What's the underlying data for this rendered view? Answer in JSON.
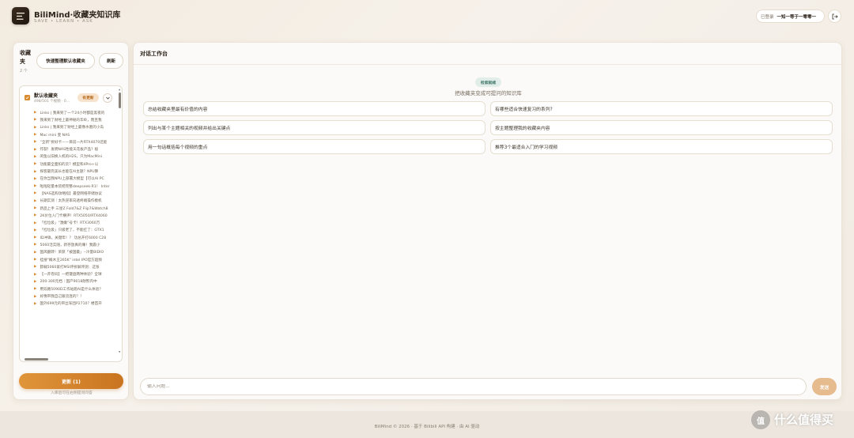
{
  "header": {
    "title": "BiliMind·收藏夹知识库",
    "subtitle": "SAVE • LEARN • ASK",
    "user_label": "已登录",
    "user_name": "一知一等于一零零一"
  },
  "sidebar": {
    "title": "收藏夹",
    "count": "2 个",
    "quick_button": "快速整理默认收藏夹",
    "refresh_button": "刷新",
    "folder": {
      "name": "默认收藏夹",
      "meta": "498/501 个视频 · 0...",
      "badge": "有更新"
    },
    "videos": [
      "Links | 我来到了一个24小时都是黑夜的",
      "我来到了财经上最神秘的华岭，而且我",
      "Links | 我来到了财经上最像水墨的小岛",
      "Mac mini 变 NAS",
      "“全新”拆好卡——目前一片RTX4070还能",
      "炸裂！发明NAS性能天花板产品？极",
      "闲鱼以旧换入机的H2S，只为MacMini",
      "功能最全面扣的云？模型和4Pro+以",
      "探客最完美长也能在AI主题？NPU算",
      "在你当我NPU上部署大模型【可以AI PC",
      "啦啦轻量本装把完整deepseek-R1！ Inter",
      "【NAS选购攻略指】最登网络存储协议",
      "长期实测｜太热逆率向透终端操作模机",
      "新品上手 三星Z Fold7&Z Flip7&Watch8",
      "2K价位入门卡横评！RTX5050/RTX4060",
      "「捡垃圾」“激嫩”号卡！RTX3060万",
      "「捡垃圾」只级老了，不能扛了：GTX1",
      "ID冲锋，关键年！？ 功总开打6000 C28",
      "5060活实随，新存放真的赚！我震小",
      "国风翻转！荣获「被国最」--冷量BIDIO",
      "挂搜“概木王265K” intel IPO官方超频",
      "卸载5060紧打MSI评拆解评测：这张",
      "【一开卷码】一把键盘两种体验？全球",
      "200-300元档｜国产9018耐熊内中",
      "用双路5090D工作站跑AI是什么体验？",
      "好像带我自己跟流连的？！",
      "国外699元的带丝军团P2710？楼首开"
    ],
    "update_button": "更新 (1)",
    "update_hint": "入库后可在右侧提问问答"
  },
  "chat": {
    "title": "对话工作台",
    "hero_tag": "检索就绪",
    "hero_sub": "把收藏夹变成可提问的知识库",
    "suggestions": [
      "总结收藏夹里最有价值的内容",
      "有哪些适合快速复习的系列?",
      "列出与某个主题相关的视频并给出关键点",
      "按主题整理我的收藏夹内容",
      "用一句话概括每个视频的重点",
      "推荐3个最适合入门的学习视频"
    ],
    "input_placeholder": "输入问题...",
    "send_button": "发送"
  },
  "footer": {
    "text": "BiliMind © 2026 · 基于 Bilibili API 构建 · 由 AI 驱动"
  },
  "watermark": {
    "icon_glyph": "值",
    "text": "什么值得买"
  },
  "colors": {
    "accent": "#d9892e",
    "accent_dark": "#c97420",
    "tag_green": "#3f7665"
  }
}
